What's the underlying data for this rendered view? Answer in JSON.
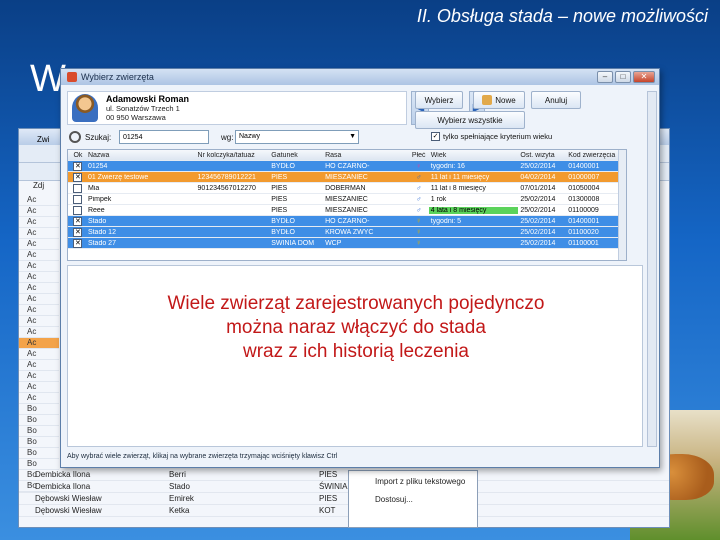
{
  "slide": {
    "title": "II. Obsługa stada – nowe możliwości",
    "big_letter": "W"
  },
  "dialog": {
    "title": "Wybierz zwierzęta",
    "user": {
      "name": "Adamowski Roman",
      "street": "ul. Sonatzów Trzech 1",
      "city": "00 950 Warszawa"
    },
    "buttons": {
      "select": "Wybierz",
      "new": "Nowe",
      "cancel": "Anuluj",
      "select_all": "Wybierz wszystkie"
    },
    "search": {
      "label": "Szukaj:",
      "value": "01254",
      "field_label": "wg:",
      "field_value": "Nazwy"
    },
    "age_filter_label": "tylko spełniające kryterium wieku",
    "columns": [
      "Ok",
      "Nazwa",
      "Nr kolczyka/tatuaż",
      "Gatunek",
      "Rasa",
      "Płeć",
      "Wiek",
      "Ost. wizyta",
      "Kod zwierzęcia"
    ],
    "rows": [
      {
        "checked": true,
        "name": "01254",
        "ear": "",
        "species": "BYDŁO",
        "breed": "HO CZARNO-",
        "sex": "♀",
        "sex_type": "f",
        "age": "tygodni: 16",
        "age_ok": false,
        "date": "25/02/2014",
        "code": "01400001",
        "style": "blue"
      },
      {
        "checked": true,
        "name": "01 Zwierzę testowe",
        "ear": "123456789012221",
        "species": "PIES",
        "breed": "MIESZANIEC",
        "sex": "♂",
        "sex_type": "m",
        "age": "11 lat i 11 miesięcy",
        "age_ok": false,
        "date": "04/02/2014",
        "code": "01000007",
        "style": "orange"
      },
      {
        "checked": false,
        "name": "Mia",
        "ear": "901234567012270",
        "species": "PIES",
        "breed": "DOBERMAN",
        "sex": "♂",
        "sex_type": "m",
        "age": "11 lat i 8 miesięcy",
        "age_ok": false,
        "date": "07/01/2014",
        "code": "01050004",
        "style": "white"
      },
      {
        "checked": false,
        "name": "Pimpek",
        "ear": "",
        "species": "PIES",
        "breed": "MIESZANIEC",
        "sex": "♂",
        "sex_type": "m",
        "age": "1 rok",
        "age_ok": false,
        "date": "25/02/2014",
        "code": "01300008",
        "style": "white"
      },
      {
        "checked": false,
        "name": "Reee",
        "ear": "",
        "species": "PIES",
        "breed": "MIESZANIEC",
        "sex": "♂",
        "sex_type": "m",
        "age": "4 lata i 8 miesięcy",
        "age_ok": true,
        "date": "25/02/2014",
        "code": "01100009",
        "style": "white"
      },
      {
        "checked": true,
        "name": "Stado",
        "ear": "",
        "species": "BYDŁO",
        "breed": "HO CZARNO-",
        "sex": "☿",
        "sex_type": "h",
        "age": "tygodni: 5",
        "age_ok": false,
        "date": "25/02/2014",
        "code": "01400001",
        "style": "blue"
      },
      {
        "checked": true,
        "name": "Stado 12",
        "ear": "",
        "species": "BYDŁO",
        "breed": "KROWA ZWYC",
        "sex": "☿",
        "sex_type": "h",
        "age": "",
        "age_ok": false,
        "date": "25/02/2014",
        "code": "01100020",
        "style": "blue"
      },
      {
        "checked": true,
        "name": "Stado 27",
        "ear": "",
        "species": "ŚWINIA DOM",
        "breed": "WCP",
        "sex": "☿",
        "sex_type": "h",
        "age": "",
        "age_ok": false,
        "date": "25/02/2014",
        "code": "01100001",
        "style": "blue"
      }
    ],
    "callout": {
      "line1": "Wiele zwierząt zarejestrowanych pojedynczo",
      "line2": "można naraz włączyć do stada",
      "line3": "wraz z ich historią leczenia"
    },
    "hint": "Aby wybrać wiele zwierząt, klikaj na wybrane zwierzęta trzymając wciśnięty klawisz Ctrl"
  },
  "background_window": {
    "title": "Zwi",
    "col_label": "Zdj",
    "side_rows": [
      "Ac",
      "Ac",
      "Ac",
      "Ac",
      "Ac",
      "Ac",
      "Ac",
      "Ac",
      "Ac",
      "Ac",
      "Ac",
      "Ac",
      "Ac",
      "Ac",
      "Ac",
      "Ac",
      "Ac",
      "Ac",
      "Ac",
      "Bo",
      "Bo",
      "Bo",
      "Bo",
      "Bo",
      "Bo",
      "Bo",
      "Bo"
    ],
    "selected_side_row": 13,
    "bottom_rows": [
      {
        "owner": "Dembicka Ilona",
        "animal": "Berri",
        "species": "PIES"
      },
      {
        "owner": "Dembicka Ilona",
        "animal": "Stado",
        "species": "ŚWINIA DOM"
      },
      {
        "owner": "Dębowski Wiesław",
        "animal": "Emirek",
        "species": "PIES"
      },
      {
        "owner": "Dębowski Wiesław",
        "animal": "Ketka",
        "species": "KOT"
      }
    ],
    "context_menu": {
      "import": "Import z pliku tekstowego",
      "customize": "Dostosuj..."
    }
  },
  "colors": {
    "selected_blue": "#3f8ee6",
    "selected_orange": "#f29a2e",
    "callout_red": "#c21818",
    "age_ok_green": "#5bd35b"
  }
}
